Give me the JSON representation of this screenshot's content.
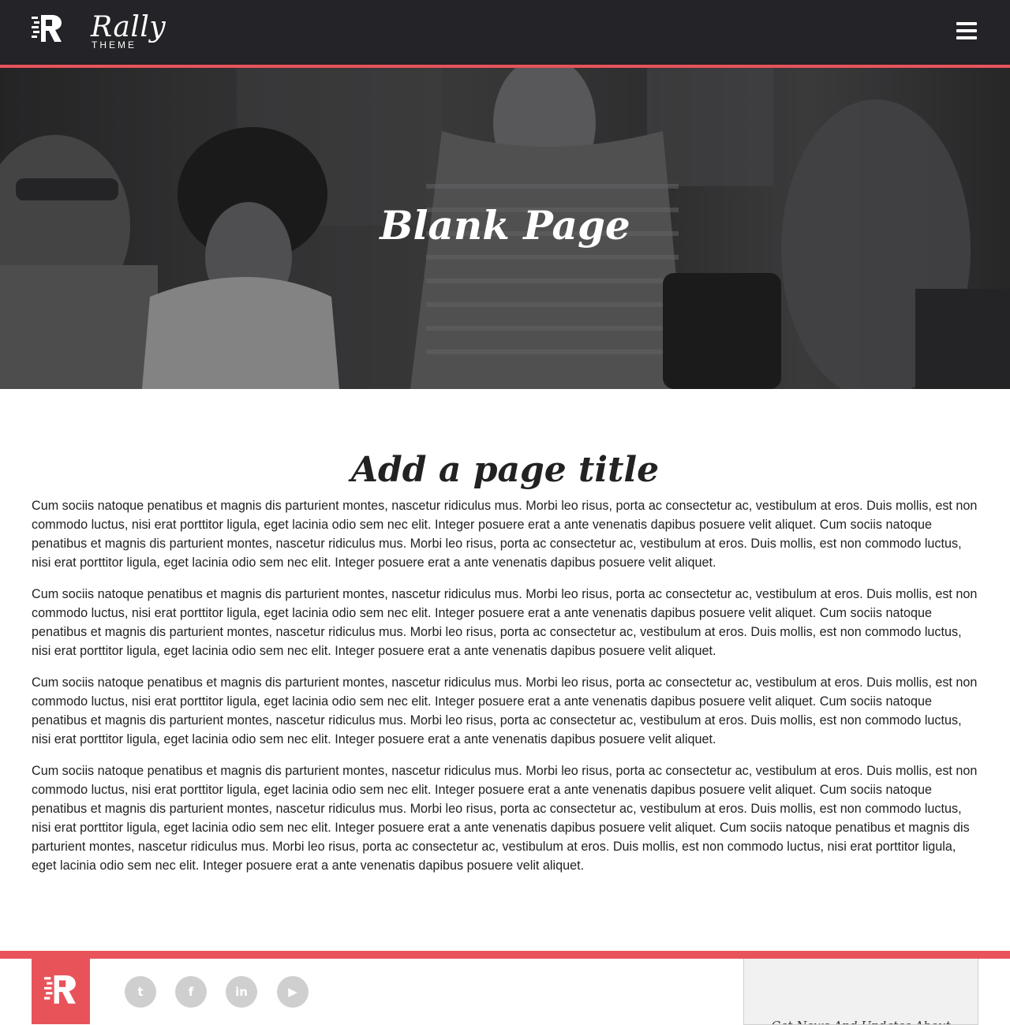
{
  "header": {
    "brand_name": "Rally",
    "brand_sub": "THEME",
    "logo_icon": "rally-r-logo-icon",
    "menu_icon": "hamburger-menu-icon"
  },
  "hero": {
    "title": "Blank Page"
  },
  "main": {
    "page_title": "Add a page title",
    "paragraphs": [
      "Cum sociis natoque penatibus et magnis dis parturient montes, nascetur ridiculus mus. Morbi leo risus, porta ac consectetur ac, vestibulum at eros. Duis mollis, est non commodo luctus, nisi erat porttitor ligula, eget lacinia odio sem nec elit. Integer posuere erat a ante venenatis dapibus posuere velit aliquet. Cum sociis natoque penatibus et magnis dis parturient montes, nascetur ridiculus mus. Morbi leo risus, porta ac consectetur ac, vestibulum at eros. Duis mollis, est non commodo luctus, nisi erat porttitor ligula, eget lacinia odio sem nec elit. Integer posuere erat a ante venenatis dapibus posuere velit aliquet.",
      "Cum sociis natoque penatibus et magnis dis parturient montes, nascetur ridiculus mus. Morbi leo risus, porta ac consectetur ac, vestibulum at eros. Duis mollis, est non commodo luctus, nisi erat porttitor ligula, eget lacinia odio sem nec elit. Integer posuere erat a ante venenatis dapibus posuere velit aliquet. Cum sociis natoque penatibus et magnis dis parturient montes, nascetur ridiculus mus. Morbi leo risus, porta ac consectetur ac, vestibulum at eros. Duis mollis, est non commodo luctus, nisi erat porttitor ligula, eget lacinia odio sem nec elit. Integer posuere erat a ante venenatis dapibus posuere velit aliquet.",
      "Cum sociis natoque penatibus et magnis dis parturient montes, nascetur ridiculus mus. Morbi leo risus, porta ac consectetur ac, vestibulum at eros. Duis mollis, est non commodo luctus, nisi erat porttitor ligula, eget lacinia odio sem nec elit. Integer posuere erat a ante venenatis dapibus posuere velit aliquet. Cum sociis natoque penatibus et magnis dis parturient montes, nascetur ridiculus mus. Morbi leo risus, porta ac consectetur ac, vestibulum at eros. Duis mollis, est non commodo luctus, nisi erat porttitor ligula, eget lacinia odio sem nec elit. Integer posuere erat a ante venenatis dapibus posuere velit aliquet.",
      "Cum sociis natoque penatibus et magnis dis parturient montes, nascetur ridiculus mus. Morbi leo risus, porta ac consectetur ac, vestibulum at eros. Duis mollis, est non commodo luctus, nisi erat porttitor ligula, eget lacinia odio sem nec elit. Integer posuere erat a ante venenatis dapibus posuere velit aliquet. Cum sociis natoque penatibus et magnis dis parturient montes, nascetur ridiculus mus. Morbi leo risus, porta ac consectetur ac, vestibulum at eros. Duis mollis, est non commodo luctus, nisi erat porttitor ligula, eget lacinia odio sem nec elit. Integer posuere erat a ante venenatis dapibus posuere velit aliquet. Cum sociis natoque penatibus et magnis dis parturient montes, nascetur ridiculus mus. Morbi leo risus, porta ac consectetur ac, vestibulum at eros. Duis mollis, est non commodo luctus, nisi erat porttitor ligula, eget lacinia odio sem nec elit. Integer posuere erat a ante venenatis dapibus posuere velit aliquet."
    ]
  },
  "footer": {
    "logo_icon": "rally-r-logo-icon",
    "social": [
      {
        "name": "twitter-icon",
        "glyph": "t"
      },
      {
        "name": "facebook-icon",
        "glyph": "f"
      },
      {
        "name": "linkedin-icon",
        "glyph": "in"
      },
      {
        "name": "youtube-icon",
        "glyph": "▶"
      }
    ],
    "newsletter_text": "Get News And Updates About"
  },
  "colors": {
    "accent": "#e8535a",
    "header_bg": "#242327",
    "social_bg": "#cfcfcf"
  }
}
